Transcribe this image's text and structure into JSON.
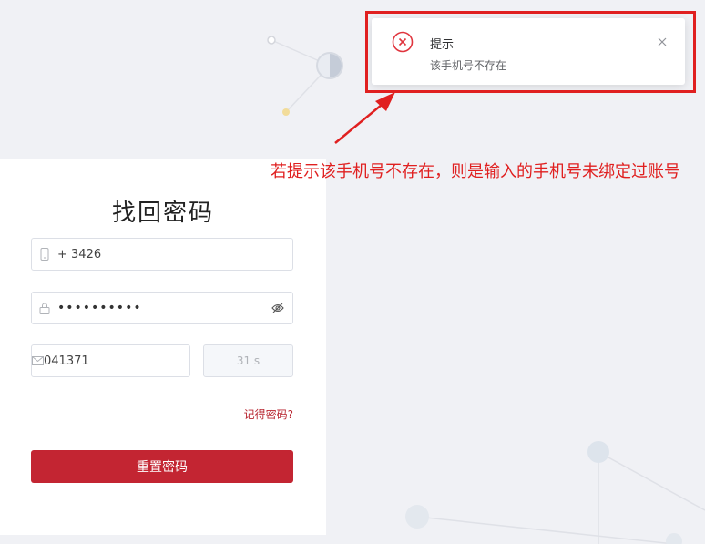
{
  "form": {
    "title": "找回密码",
    "phone_value": "+ 3426",
    "password_dots": "••••••••••",
    "code_value": "041371",
    "countdown_label": "31 s",
    "remember_link": "记得密码?",
    "reset_button": "重置密码"
  },
  "notification": {
    "title": "提示",
    "message": "该手机号不存在"
  },
  "annotation": {
    "text": "若提示该手机号不存在，则是输入的手机号未绑定过账号"
  },
  "colors": {
    "primary": "#c32532",
    "annotation": "#e02020",
    "error_icon": "#e0353e"
  },
  "icons": [
    "phone-icon",
    "lock-icon",
    "eye-hidden-icon",
    "mail-icon",
    "error-icon",
    "close-icon"
  ]
}
